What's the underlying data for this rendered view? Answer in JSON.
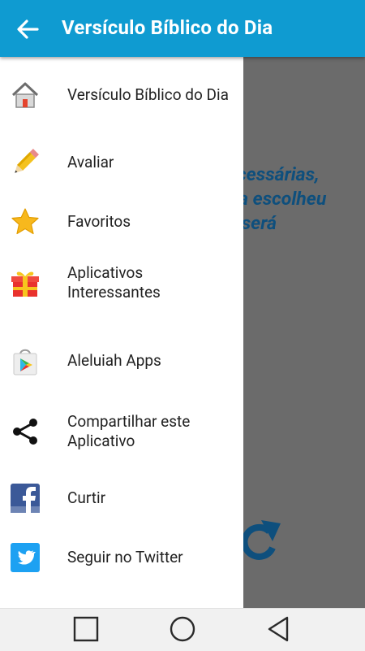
{
  "appbar": {
    "title": "Versículo Bíblico do Dia",
    "color": "#0f9bd1"
  },
  "background": {
    "verse_lines": [
      "ecessárias,",
      "ria escolheu",
      "e será"
    ],
    "verse_color": "#0e4f7d"
  },
  "drawer": {
    "items": [
      {
        "label": "Versículo Bíblico do Dia",
        "icon": "home-icon"
      },
      {
        "label": "Avaliar",
        "icon": "pencil-icon"
      },
      {
        "label": "Favoritos",
        "icon": "star-icon"
      },
      {
        "label": "Aplicativos Interessantes",
        "icon": "gift-icon"
      },
      {
        "label": "Aleluiah Apps",
        "icon": "play-store-icon"
      },
      {
        "label": "Compartilhar este Aplicativo",
        "icon": "share-icon"
      },
      {
        "label": "Curtir",
        "icon": "facebook-icon"
      },
      {
        "label": "Seguir no Twitter",
        "icon": "twitter-icon"
      }
    ]
  },
  "navbar": {
    "buttons": [
      "recents-button",
      "home-button",
      "back-button"
    ]
  }
}
